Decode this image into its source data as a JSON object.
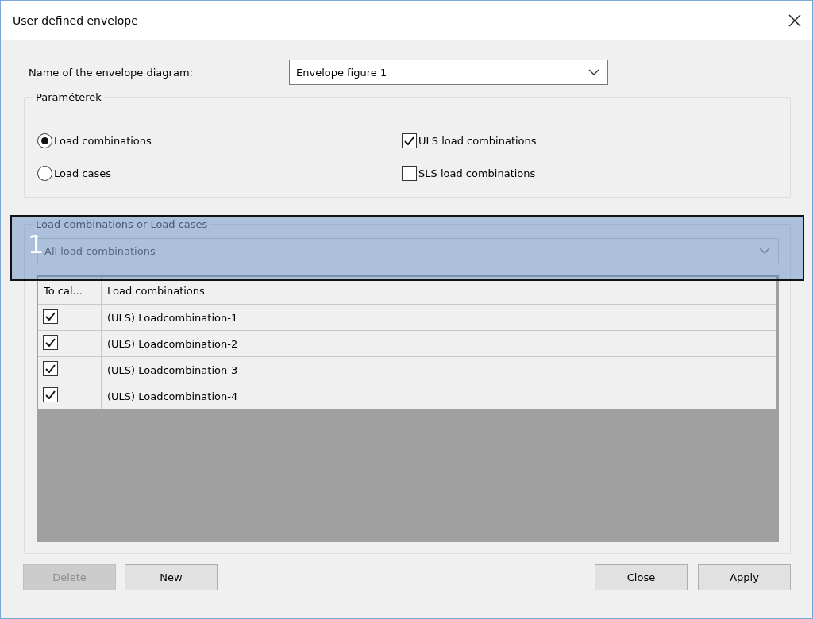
{
  "window": {
    "title": "User defined envelope"
  },
  "name_field": {
    "label": "Name of the envelope diagram:",
    "value": "Envelope figure 1"
  },
  "parameters": {
    "title": "Paraméterek",
    "options": [
      {
        "label": "Load combinations",
        "selected": true
      },
      {
        "label": "Load cases",
        "selected": false
      }
    ],
    "checks": [
      {
        "label": "ULS load combinations",
        "checked": true
      },
      {
        "label": "SLS load combinations",
        "checked": false
      }
    ]
  },
  "selection": {
    "title": "Load combinations or Load cases",
    "disabled": true,
    "value": "All load combinations"
  },
  "table": {
    "columns": [
      "To cal...",
      "Load combinations"
    ],
    "rows": [
      {
        "checked": true,
        "name": "(ULS) Loadcombination-1"
      },
      {
        "checked": true,
        "name": "(ULS) Loadcombination-2"
      },
      {
        "checked": true,
        "name": "(ULS) Loadcombination-3"
      },
      {
        "checked": true,
        "name": "(ULS) Loadcombination-4"
      }
    ]
  },
  "buttons": [
    {
      "label": "Delete",
      "disabled": true
    },
    {
      "label": "New",
      "disabled": false
    },
    {
      "label": "Close",
      "disabled": false
    },
    {
      "label": "Apply",
      "disabled": false
    }
  ],
  "callout": {
    "label": "1"
  }
}
